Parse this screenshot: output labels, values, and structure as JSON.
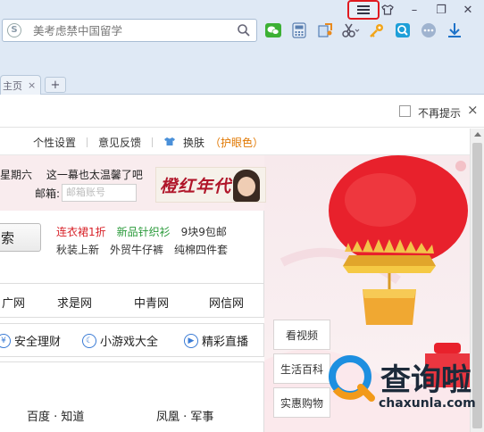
{
  "browser": {
    "address_placeholder": "美考虑禁中国留学",
    "tab_label": "主页",
    "tab_close": "×",
    "new_tab": "+",
    "window_buttons": [
      "–",
      "❐",
      "✕"
    ],
    "toolbar_icons": [
      "wechat-icon",
      "calculator-icon",
      "screenshot-icon",
      "scissors-icon",
      "key-icon",
      "magnifier-icon",
      "more-icon",
      "download-icon"
    ]
  },
  "notification": {
    "dont_remind": "不再提示",
    "close": "×"
  },
  "topnav": {
    "settings": "个性设置",
    "feedback": "意见反馈",
    "skin": "换肤",
    "eyecare": "（护眼色）"
  },
  "header": {
    "weekday": "星期六",
    "greeting": "这一幕也太温馨了吧",
    "mail_label": "邮箱:",
    "mail_placeholder": "邮箱账号",
    "ad_title": "橙红年代"
  },
  "search": {
    "button": "索",
    "links_row1": [
      "连衣裙1折",
      "新品针织衫",
      "9块9包邮"
    ],
    "links_row2": [
      "秋装上新",
      "外贸牛仔裤",
      "纯棉四件套"
    ]
  },
  "sites": [
    "广网",
    "求是网",
    "中青网",
    "网信网"
  ],
  "quick_links": [
    "安全理财",
    "小游戏大全",
    "精彩直播"
  ],
  "news": [
    "百度 · 知道",
    "凤凰 · 军事"
  ],
  "side_tabs": [
    "看视频",
    "生活百科",
    "实惠购物"
  ],
  "watermark": {
    "title": "查询啦",
    "subtitle": "chaxunla.com"
  }
}
